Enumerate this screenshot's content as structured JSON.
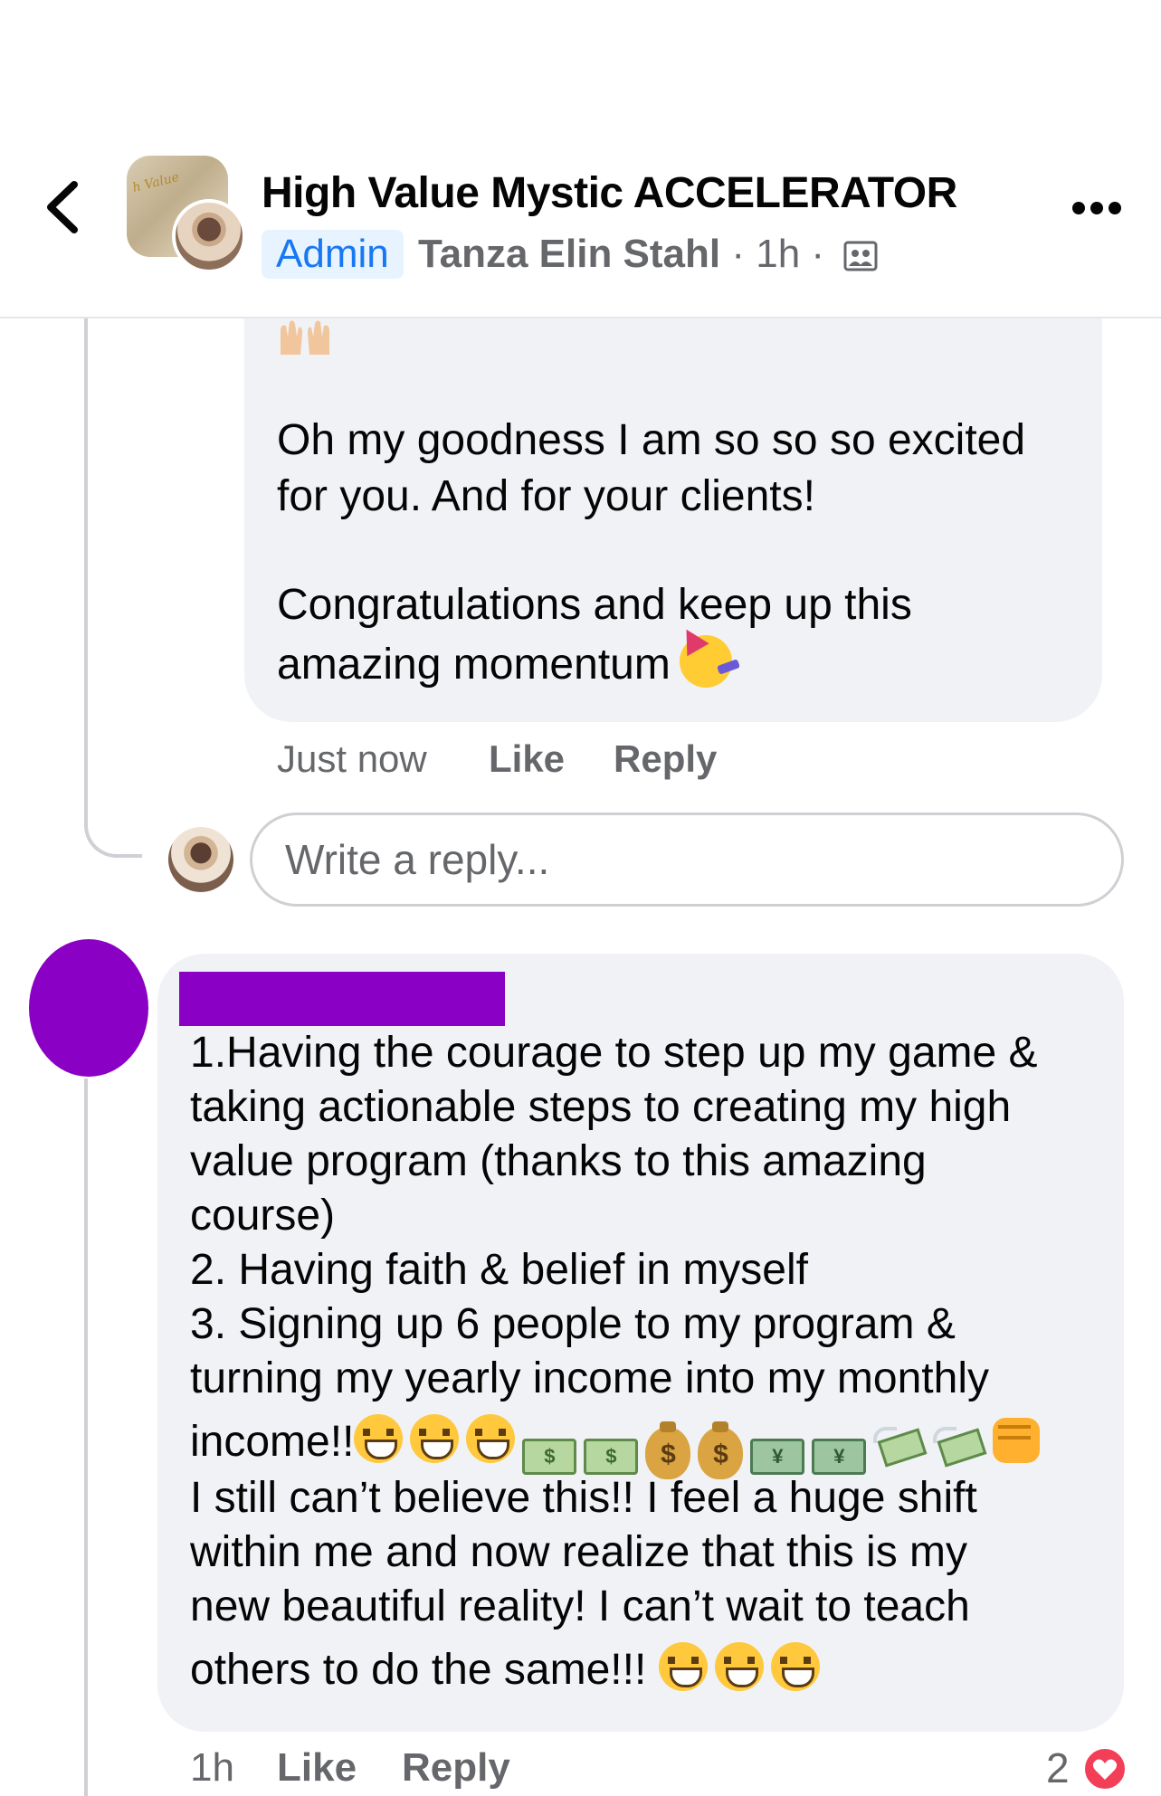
{
  "header": {
    "title": "High Value Mystic ACCELERATOR",
    "badge": "Admin",
    "author": "Tanza Elin Stahl",
    "time_sep": " · 1h · ",
    "group_avatar_text": "h Value"
  },
  "reply": {
    "top_emoji": "raised-hands",
    "line1": "Oh my goodness I am so so so excited",
    "line2": "for you. And for your clients!",
    "line3": "Congratulations and keep up this",
    "line4": "amazing momentum",
    "time": "Just now",
    "like_label": "Like",
    "reply_label": "Reply"
  },
  "reply_input": {
    "placeholder": "Write a reply..."
  },
  "comment": {
    "lines": [
      "1.Having the courage to step up my game &",
      "taking actionable steps to creating my high",
      "value program (thanks to this amazing",
      "course)",
      "2. Having faith & belief in myself",
      "3. Signing up 6 people to my program &",
      "turning my yearly income into my monthly",
      "income!!",
      "I still can’t believe this!! I feel a huge shift",
      "within me and now realize that this is my",
      "new beautiful reality! I can’t wait to teach",
      "others to do the same!!!"
    ],
    "bill_symbol": "$",
    "bag_symbol": "$",
    "yen_symbol": "¥",
    "time": "1h",
    "like_label": "Like",
    "reply_label": "Reply",
    "reaction_count": "2"
  },
  "colors": {
    "accent": "#1877f2",
    "bubble": "#f0f2f5",
    "redaction": "#8a00c4",
    "heart": "#f33e58"
  }
}
